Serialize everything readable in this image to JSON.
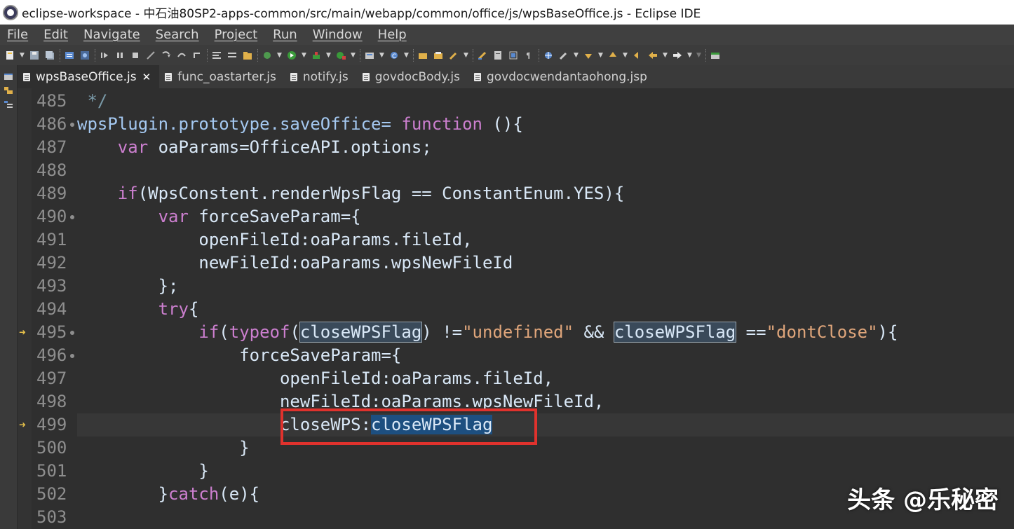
{
  "window": {
    "title": "eclipse-workspace - 中石油80SP2-apps-common/src/main/webapp/common/office/js/wpsBaseOffice.js - Eclipse IDE"
  },
  "menu": [
    "File",
    "Edit",
    "Navigate",
    "Search",
    "Project",
    "Run",
    "Window",
    "Help"
  ],
  "tabs": [
    {
      "label": "wpsBaseOffice.js",
      "active": true,
      "close": "✕"
    },
    {
      "label": "func_oastarter.js",
      "active": false
    },
    {
      "label": "notify.js",
      "active": false
    },
    {
      "label": "govdocBody.js",
      "active": false
    },
    {
      "label": "govdocwendantaohong.jsp",
      "active": false
    }
  ],
  "editor": {
    "lines": [
      {
        "num": "485",
        "tokens": [
          {
            "t": " */",
            "c": "cmt"
          }
        ]
      },
      {
        "num": "486",
        "fold": true,
        "tokens": [
          {
            "t": "wpsPlugin.prototype.saveOffice= ",
            "c": "fn"
          },
          {
            "t": "function",
            "c": "kw"
          },
          {
            "t": " (){",
            "c": "def"
          }
        ]
      },
      {
        "num": "487",
        "tokens": [
          {
            "t": "    ",
            "c": "def"
          },
          {
            "t": "var",
            "c": "kw"
          },
          {
            "t": " oaParams=OfficeAPI.options;",
            "c": "def"
          }
        ]
      },
      {
        "num": "488",
        "tokens": []
      },
      {
        "num": "489",
        "tokens": [
          {
            "t": "    ",
            "c": "def"
          },
          {
            "t": "if",
            "c": "kw"
          },
          {
            "t": "(WpsConstent.renderWpsFlag == ConstantEnum.YES){",
            "c": "def"
          }
        ]
      },
      {
        "num": "490",
        "fold": true,
        "tokens": [
          {
            "t": "        ",
            "c": "def"
          },
          {
            "t": "var",
            "c": "kw"
          },
          {
            "t": " forceSaveParam={",
            "c": "def"
          }
        ]
      },
      {
        "num": "491",
        "tokens": [
          {
            "t": "            openFileId:oaParams.fileId,",
            "c": "def"
          }
        ]
      },
      {
        "num": "492",
        "tokens": [
          {
            "t": "            newFileId:oaParams.wpsNewFileId",
            "c": "def"
          }
        ]
      },
      {
        "num": "493",
        "tokens": [
          {
            "t": "        };",
            "c": "def"
          }
        ]
      },
      {
        "num": "494",
        "tokens": [
          {
            "t": "        ",
            "c": "def"
          },
          {
            "t": "try",
            "c": "kw"
          },
          {
            "t": "{",
            "c": "def"
          }
        ]
      },
      {
        "num": "495",
        "fold": true,
        "arrow": true,
        "tokens": [
          {
            "t": "            ",
            "c": "def"
          },
          {
            "t": "if",
            "c": "kw"
          },
          {
            "t": "(",
            "c": "def"
          },
          {
            "t": "typeof",
            "c": "kw"
          },
          {
            "t": "(",
            "c": "def"
          },
          {
            "t": "closeWPSFlag",
            "c": "occ"
          },
          {
            "t": ") !=",
            "c": "def"
          },
          {
            "t": "\"undefined\"",
            "c": "str"
          },
          {
            "t": " && ",
            "c": "def"
          },
          {
            "t": "closeWPSFlag",
            "c": "occ"
          },
          {
            "t": " ==",
            "c": "def"
          },
          {
            "t": "\"dontClose\"",
            "c": "str"
          },
          {
            "t": "){",
            "c": "def"
          }
        ]
      },
      {
        "num": "496",
        "fold": true,
        "tokens": [
          {
            "t": "                forceSaveParam={",
            "c": "def"
          }
        ]
      },
      {
        "num": "497",
        "tokens": [
          {
            "t": "                    openFileId:oaParams.fileId,",
            "c": "def"
          }
        ]
      },
      {
        "num": "498",
        "tokens": [
          {
            "t": "                    newFileId:oaParams.wpsNewFileId,",
            "c": "def"
          }
        ]
      },
      {
        "num": "499",
        "arrow": true,
        "current": true,
        "tokens": [
          {
            "t": "                    closeWPS:",
            "c": "def"
          },
          {
            "t": "closeWPSFlag",
            "c": "sel"
          }
        ]
      },
      {
        "num": "500",
        "tokens": [
          {
            "t": "                }",
            "c": "def"
          }
        ]
      },
      {
        "num": "501",
        "tokens": [
          {
            "t": "            }",
            "c": "def"
          }
        ]
      },
      {
        "num": "502",
        "tokens": [
          {
            "t": "        }",
            "c": "def"
          },
          {
            "t": "catch",
            "c": "kw"
          },
          {
            "t": "(e){",
            "c": "def"
          }
        ]
      },
      {
        "num": "503",
        "tokens": []
      }
    ]
  },
  "watermark": "头条 @乐秘密",
  "colors": {
    "keyword": "#cc7fcf",
    "string": "#e0a67b",
    "highlight_box": "#e0322d",
    "selection": "#1d4f80"
  }
}
